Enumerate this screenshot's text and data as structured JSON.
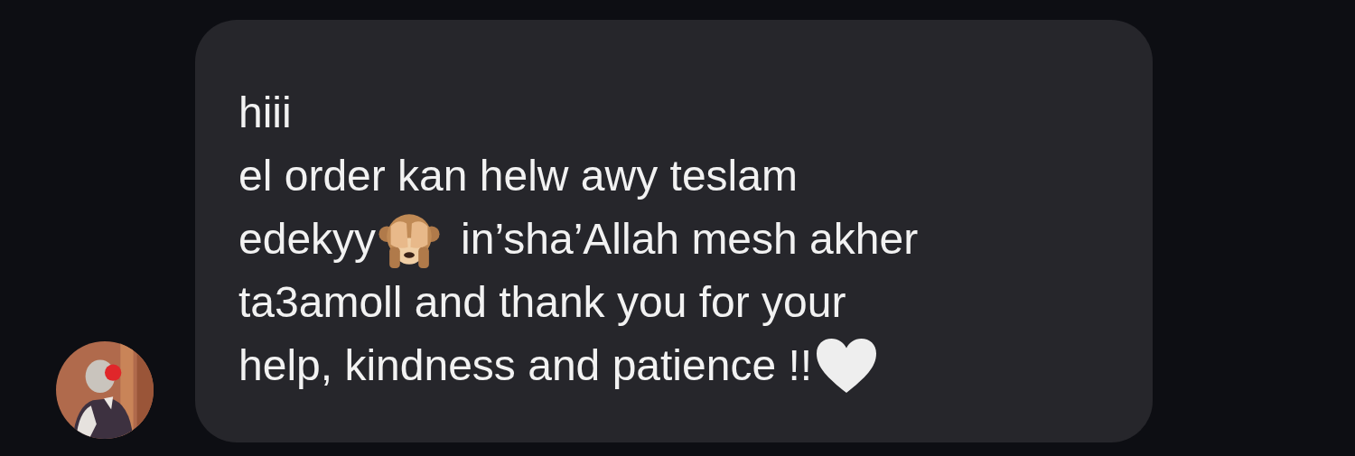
{
  "message": {
    "lines": [
      [
        {
          "kind": "text",
          "text": "hiii"
        }
      ],
      [
        {
          "kind": "text",
          "text": "el order kan helw awy teslam"
        }
      ],
      [
        {
          "kind": "text",
          "text": "edekyy"
        },
        {
          "kind": "monkey"
        },
        {
          "kind": "text",
          "text": "in’sha’Allah mesh akher"
        }
      ],
      [
        {
          "kind": "text",
          "text": "ta3amoll and thank you for your"
        }
      ],
      [
        {
          "kind": "text",
          "text": "help, kindness and patience !!"
        },
        {
          "kind": "heart"
        }
      ]
    ]
  }
}
